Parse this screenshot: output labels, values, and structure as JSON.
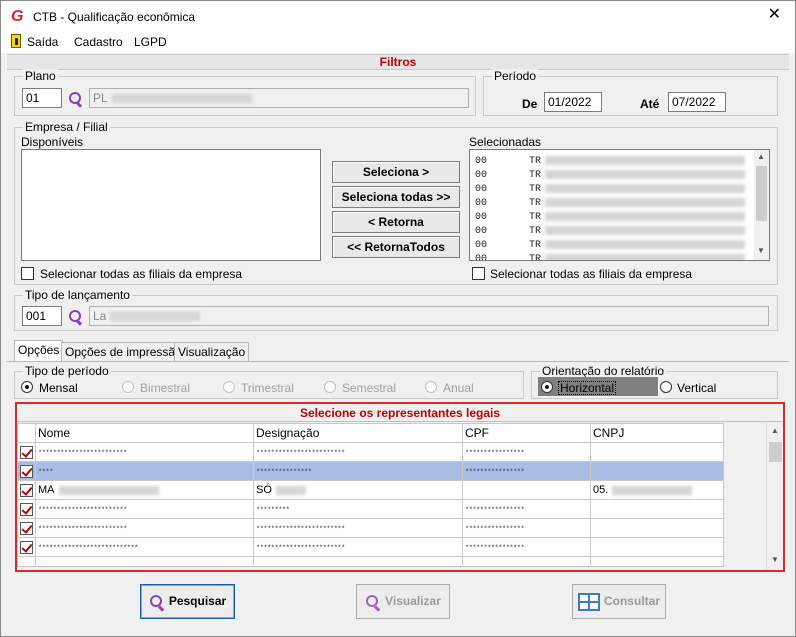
{
  "window": {
    "title": "CTB - Qualificação econômica"
  },
  "menu": {
    "items": [
      "Saída",
      "Cadastro",
      "LGPD"
    ]
  },
  "filters": {
    "header": "Filtros",
    "plano": {
      "label": "Plano",
      "code": "01",
      "name": "PL"
    },
    "periodo": {
      "label": "Período",
      "de_label": "De",
      "de_value": "01/2022",
      "ate_label": "Até",
      "ate_value": "07/2022"
    },
    "empresa": {
      "label": "Empresa / Filial",
      "disponiveis_label": "Disponíveis",
      "selecionadas_label": "Selecionadas",
      "selecionadas_rows": [
        {
          "code": "00",
          "name": "TR"
        },
        {
          "code": "00",
          "name": "TR"
        },
        {
          "code": "00",
          "name": "TR"
        },
        {
          "code": "00",
          "name": "TR"
        },
        {
          "code": "00",
          "name": "TR"
        },
        {
          "code": "00",
          "name": "TR"
        },
        {
          "code": "00",
          "name": "TR"
        },
        {
          "code": "00",
          "name": "TR"
        }
      ],
      "buttons": {
        "seleciona": "Seleciona >",
        "seleciona_todas": "Seleciona todas >>",
        "retorna": "< Retorna",
        "retorna_todos": "<< RetornaTodos"
      },
      "check_left": "Selecionar todas as filiais da empresa",
      "check_right": "Selecionar todas as filiais da empresa"
    },
    "tipo_lancamento": {
      "label": "Tipo de  lançamento",
      "code": "001",
      "name": "La"
    }
  },
  "tabs": [
    "Opções",
    "Opções de impressão",
    "Visualização"
  ],
  "tipo_periodo": {
    "label": "Tipo de período",
    "options": [
      "Mensal",
      "Bimestral",
      "Trimestral",
      "Semestral",
      "Anual"
    ],
    "selected": "Mensal"
  },
  "orientacao": {
    "label": "Orientação do relatório",
    "options": [
      "Horizontal",
      "Vertical"
    ],
    "selected": "Horizontal"
  },
  "representantes": {
    "title": "Selecione os representantes legais",
    "columns": [
      "Nome",
      "Designação",
      "CPF",
      "CNPJ"
    ],
    "rows": [
      {
        "checked": true,
        "nome": "************************",
        "designacao": "************************",
        "cpf": "****************",
        "cnpj": ""
      },
      {
        "checked": true,
        "nome": "****",
        "designacao": "***************",
        "cpf": "****************",
        "cnpj": ""
      },
      {
        "checked": true,
        "nome": "MA",
        "designacao": "SÓ",
        "cpf": "",
        "cnpj": "05."
      },
      {
        "checked": true,
        "nome": "************************",
        "designacao": "*********",
        "cpf": "****************",
        "cnpj": ""
      },
      {
        "checked": true,
        "nome": "************************",
        "designacao": "************************",
        "cpf": "****************",
        "cnpj": ""
      },
      {
        "checked": true,
        "nome": "***************************",
        "designacao": "************************",
        "cpf": "****************",
        "cnpj": ""
      }
    ]
  },
  "actions": {
    "pesquisar": "Pesquisar",
    "visualizar": "Visualizar",
    "consultar": "Consultar"
  }
}
